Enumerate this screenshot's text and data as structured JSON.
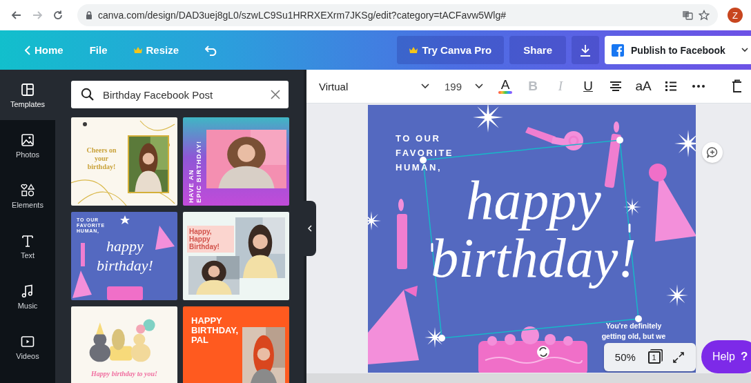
{
  "browser": {
    "url": "canva.com/design/DAD3uej8gL0/szwLC9Su1HRRXEXrm7JKSg/edit?category=tACFavw5Wlg#",
    "avatar": "Z"
  },
  "header": {
    "left": [
      {
        "kind": "back",
        "label": "Home"
      },
      {
        "kind": "plain",
        "label": "File"
      },
      {
        "kind": "crown",
        "label": "Resize"
      },
      {
        "kind": "undo"
      }
    ],
    "pro": "Try Canva Pro",
    "share": "Share",
    "publish": "Publish to Facebook"
  },
  "rail": [
    {
      "kind": "templates",
      "label": "Templates",
      "selected": true
    },
    {
      "kind": "photos",
      "label": "Photos",
      "selected": false
    },
    {
      "kind": "elements",
      "label": "Elements",
      "selected": false
    },
    {
      "kind": "text",
      "label": "Text",
      "selected": false
    },
    {
      "kind": "music",
      "label": "Music",
      "selected": false
    },
    {
      "kind": "videos",
      "label": "Videos",
      "selected": false
    }
  ],
  "search": {
    "value": "Birthday Facebook Post"
  },
  "templates": [
    {
      "kind": "photo-right",
      "title": "Cheers on your birthday!"
    },
    {
      "kind": "vertical-title",
      "title": "HAVE AN\nEPIC BIRTHDAY!"
    },
    {
      "kind": "illustrated",
      "greeting": "TO OUR FAVORITE HUMAN,",
      "title": "happy birthday!"
    },
    {
      "kind": "collage",
      "title": "Happy, Happy Birthday!"
    },
    {
      "kind": "caption-bottom",
      "title": "Happy birthday to you!"
    },
    {
      "kind": "photo-overlay",
      "title": "HAPPY BIRTHDAY, PAL"
    }
  ],
  "toolbar": {
    "font": "Virtual",
    "size": "199",
    "color_button": "A",
    "styles": [
      {
        "label": "B",
        "disabled": true
      },
      {
        "label": "I",
        "disabled": true
      },
      {
        "label": "U",
        "disabled": false
      }
    ],
    "case_button": "aA"
  },
  "design": {
    "greeting": "TO OUR FAVORITE HUMAN,",
    "headline": "happy birthday!",
    "note": "You're definitely getting old, but we"
  },
  "zoom": {
    "value": "50%",
    "page": "1"
  },
  "help": {
    "label": "Help",
    "icon": "?"
  }
}
